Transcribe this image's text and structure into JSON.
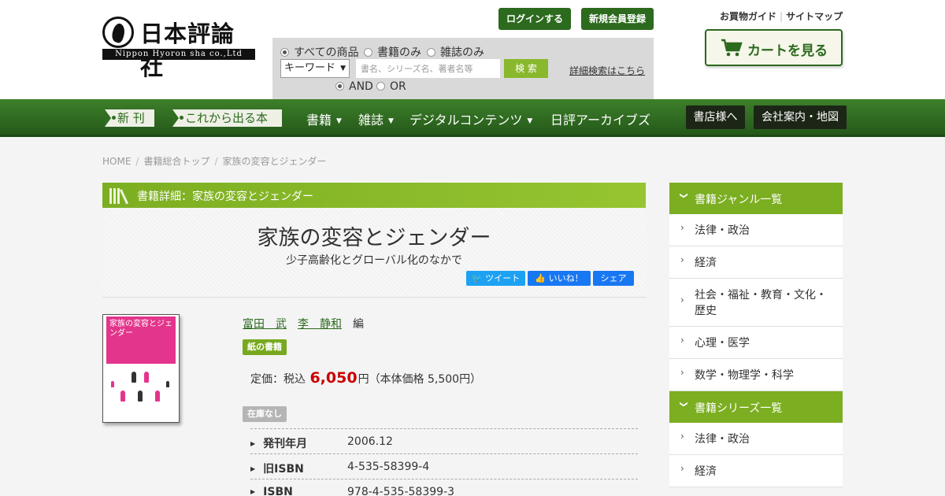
{
  "header": {
    "logo_text": "日本評論社",
    "logo_sub": "Nippon Hyoron sha co.,Ltd",
    "login": "ログインする",
    "register": "新規会員登録",
    "guide": "お買物ガイド",
    "sitemap": "サイトマップ",
    "cart": "カートを見る"
  },
  "search": {
    "scope_all": "すべての商品",
    "scope_books": "書籍のみ",
    "scope_magazines": "雑誌のみ",
    "select_value": "キーワード",
    "placeholder": "書名、シリーズ名、著者名等",
    "button": "検 索",
    "advanced": "詳細検索はこちら",
    "and": "AND",
    "or": "OR"
  },
  "nav": {
    "new": "新 刊",
    "coming": "これから出る本",
    "books": "書籍",
    "magazines": "雑誌",
    "digital": "デジタルコンテンツ",
    "archives": "日評アーカイブズ",
    "bookstore": "書店様へ",
    "company": "会社案内・地図"
  },
  "breadcrumb": [
    "HOME",
    "書籍総合トップ",
    "家族の変容とジェンダー"
  ],
  "book": {
    "section_title": "書籍詳細：家族の変容とジェンダー",
    "title": "家族の変容とジェンダー",
    "subtitle": "少子高齢化とグローバル化のなかで",
    "tweet": "ツイート",
    "like": "いいね！",
    "share": "シェア",
    "cover_title": "家族の変容とジェンダー",
    "authors": [
      "富田　武",
      "李　静和"
    ],
    "author_role": "編",
    "format_badge": "紙の書籍",
    "price_label": "定価：税込",
    "price": "6,050",
    "price_unit": "円",
    "price_note": "（本体価格 5,500円）",
    "stock_badge": "在庫なし",
    "info": [
      {
        "label": "発刊年月",
        "value": "2006.12"
      },
      {
        "label": "旧ISBN",
        "value": "4-535-58399-4"
      },
      {
        "label": "ISBN",
        "value": "978-4-535-58399-3"
      }
    ]
  },
  "sidebar": {
    "genre_title": "書籍ジャンル一覧",
    "genres": [
      "法律・政治",
      "経済",
      "社会・福祉・教育・文化・歴史",
      "心理・医学",
      "数学・物理学・科学"
    ],
    "series_title": "書籍シリーズ一覧",
    "series": [
      "法律・政治",
      "経済"
    ]
  },
  "colors": {
    "brand_green": "#2c6a1e",
    "accent_green": "#7cae21",
    "price_red": "#cc0000"
  }
}
